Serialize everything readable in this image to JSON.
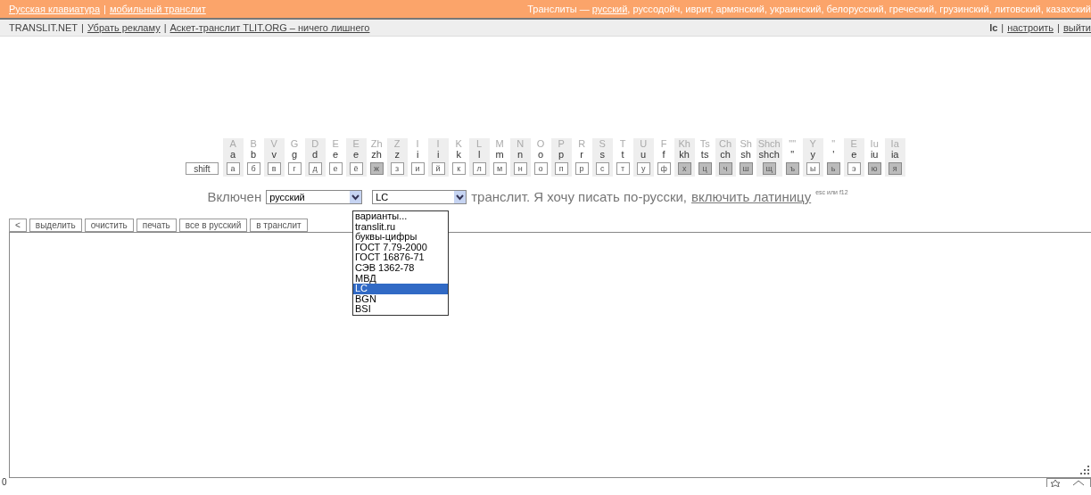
{
  "separator": "|",
  "comma": ",",
  "top_bar": {
    "links": [
      "Русская клавиатура",
      "мобильный транслит"
    ],
    "translits_label": "Транслиты —",
    "languages": [
      {
        "label": "русский",
        "selected": true
      },
      {
        "label": "руссодойч",
        "selected": false
      },
      {
        "label": "иврит",
        "selected": false
      },
      {
        "label": "армянский",
        "selected": false
      },
      {
        "label": "украинский",
        "selected": false
      },
      {
        "label": "белорусский",
        "selected": false
      },
      {
        "label": "греческий",
        "selected": false
      },
      {
        "label": "грузинский",
        "selected": false
      },
      {
        "label": "литовский",
        "selected": false
      },
      {
        "label": "казахский",
        "selected": false
      }
    ]
  },
  "sub_bar": {
    "site": "TRANSLIT.NET",
    "links": [
      "Убрать рекламу",
      "Аскет-транслит TLIT.ORG – ничего лишнего"
    ],
    "user": "lc",
    "user_links": [
      "настроить",
      "выйти"
    ]
  },
  "keyboard": {
    "shift": "shift",
    "columns": [
      {
        "upper": "A",
        "lower": "a",
        "key": "а",
        "highlighted": false
      },
      {
        "upper": "B",
        "lower": "b",
        "key": "б",
        "highlighted": false
      },
      {
        "upper": "V",
        "lower": "v",
        "key": "в",
        "highlighted": false
      },
      {
        "upper": "G",
        "lower": "g",
        "key": "г",
        "highlighted": false
      },
      {
        "upper": "D",
        "lower": "d",
        "key": "д",
        "highlighted": false
      },
      {
        "upper": "E",
        "lower": "e",
        "key": "е",
        "highlighted": false
      },
      {
        "upper": "E",
        "lower": "e",
        "key": "ё",
        "highlighted": false
      },
      {
        "upper": "Zh",
        "lower": "zh",
        "key": "ж",
        "highlighted": true
      },
      {
        "upper": "Z",
        "lower": "z",
        "key": "з",
        "highlighted": false
      },
      {
        "upper": "I",
        "lower": "i",
        "key": "и",
        "highlighted": false
      },
      {
        "upper": "I",
        "lower": "i",
        "key": "й",
        "highlighted": false
      },
      {
        "upper": "K",
        "lower": "k",
        "key": "к",
        "highlighted": false
      },
      {
        "upper": "L",
        "lower": "l",
        "key": "л",
        "highlighted": false
      },
      {
        "upper": "M",
        "lower": "m",
        "key": "м",
        "highlighted": false
      },
      {
        "upper": "N",
        "lower": "n",
        "key": "н",
        "highlighted": false
      },
      {
        "upper": "O",
        "lower": "o",
        "key": "о",
        "highlighted": false
      },
      {
        "upper": "P",
        "lower": "p",
        "key": "п",
        "highlighted": false
      },
      {
        "upper": "R",
        "lower": "r",
        "key": "р",
        "highlighted": false
      },
      {
        "upper": "S",
        "lower": "s",
        "key": "с",
        "highlighted": false
      },
      {
        "upper": "T",
        "lower": "t",
        "key": "т",
        "highlighted": false
      },
      {
        "upper": "U",
        "lower": "u",
        "key": "у",
        "highlighted": false
      },
      {
        "upper": "F",
        "lower": "f",
        "key": "ф",
        "highlighted": false
      },
      {
        "upper": "Kh",
        "lower": "kh",
        "key": "х",
        "highlighted": true
      },
      {
        "upper": "Ts",
        "lower": "ts",
        "key": "ц",
        "highlighted": true
      },
      {
        "upper": "Ch",
        "lower": "ch",
        "key": "ч",
        "highlighted": true
      },
      {
        "upper": "Sh",
        "lower": "sh",
        "key": "ш",
        "highlighted": true
      },
      {
        "upper": "Shch",
        "lower": "shch",
        "key": "щ",
        "highlighted": true
      },
      {
        "upper": "\"\"",
        "lower": "\"",
        "key": "ъ",
        "highlighted": true
      },
      {
        "upper": "Y",
        "lower": "y",
        "key": "ы",
        "highlighted": false
      },
      {
        "upper": "\"",
        "lower": "'",
        "key": "ь",
        "highlighted": true
      },
      {
        "upper": "E",
        "lower": "e",
        "key": "э",
        "highlighted": false
      },
      {
        "upper": "Iu",
        "lower": "iu",
        "key": "ю",
        "highlighted": true
      },
      {
        "upper": "Ia",
        "lower": "ia",
        "key": "я",
        "highlighted": true
      }
    ]
  },
  "mode_line": {
    "label": "Включен",
    "language_select": "русский",
    "scheme_select": "LC",
    "text": "транслит. Я хочу писать по-русски,",
    "link": "включить латиницу",
    "hint": "esc или f12"
  },
  "scheme_options": [
    {
      "label": "варианты...",
      "selected": false
    },
    {
      "label": "translit.ru",
      "selected": false
    },
    {
      "label": "буквы-цифры",
      "selected": false
    },
    {
      "label": "ГОСТ 7.79-2000",
      "selected": false
    },
    {
      "label": "ГОСТ 16876-71",
      "selected": false
    },
    {
      "label": "СЭВ 1362-78",
      "selected": false
    },
    {
      "label": "МВД",
      "selected": false
    },
    {
      "label": "LC",
      "selected": true
    },
    {
      "label": "BGN",
      "selected": false
    },
    {
      "label": "BSI",
      "selected": false
    }
  ],
  "toolbar": [
    "<",
    "выделить",
    "очистить",
    "печать",
    "все в русский",
    "в транслит"
  ],
  "counter": "0"
}
